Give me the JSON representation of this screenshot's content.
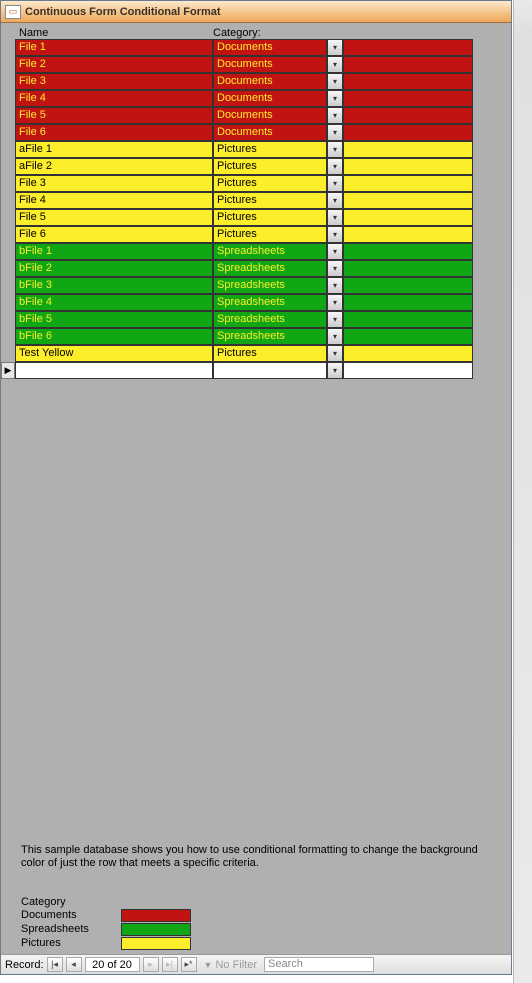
{
  "window": {
    "title": "Continuous Form Conditional Format"
  },
  "headers": {
    "name": "Name",
    "category": "Category:"
  },
  "rows": [
    {
      "name": "File 1",
      "category": "Documents",
      "class": "bg-red"
    },
    {
      "name": "File 2",
      "category": "Documents",
      "class": "bg-red"
    },
    {
      "name": "File 3",
      "category": "Documents",
      "class": "bg-red"
    },
    {
      "name": "File 4",
      "category": "Documents",
      "class": "bg-red"
    },
    {
      "name": "File 5",
      "category": "Documents",
      "class": "bg-red"
    },
    {
      "name": "File 6",
      "category": "Documents",
      "class": "bg-red"
    },
    {
      "name": "aFile 1",
      "category": "Pictures",
      "class": "bg-yellow"
    },
    {
      "name": "aFile 2",
      "category": "Pictures",
      "class": "bg-yellow"
    },
    {
      "name": "File 3",
      "category": "Pictures",
      "class": "bg-yellow"
    },
    {
      "name": "File 4",
      "category": "Pictures",
      "class": "bg-yellow"
    },
    {
      "name": "File 5",
      "category": "Pictures",
      "class": "bg-yellow"
    },
    {
      "name": "File 6",
      "category": "Pictures",
      "class": "bg-yellow"
    },
    {
      "name": "bFile 1",
      "category": "Spreadsheets",
      "class": "bg-green"
    },
    {
      "name": "bFile 2",
      "category": "Spreadsheets",
      "class": "bg-green"
    },
    {
      "name": "bFile 3",
      "category": "Spreadsheets",
      "class": "bg-green"
    },
    {
      "name": "bFile 4",
      "category": "Spreadsheets",
      "class": "bg-green"
    },
    {
      "name": "bFile 5",
      "category": "Spreadsheets",
      "class": "bg-green"
    },
    {
      "name": "bFile 6",
      "category": "Spreadsheets",
      "class": "bg-green"
    },
    {
      "name": "Test Yellow",
      "category": "Pictures",
      "class": "bg-yellow"
    }
  ],
  "new_row": {
    "name": "",
    "category": "",
    "class": "bg-white",
    "current": true
  },
  "footer": {
    "text": "This sample database shows you how to use conditional formatting to change the background color of just the row that meets a specific criteria."
  },
  "legend": {
    "title": "Category",
    "items": [
      {
        "label": "Documents",
        "color": "#c21313"
      },
      {
        "label": "Spreadsheets",
        "color": "#11a614"
      },
      {
        "label": "Pictures",
        "color": "#fcee2a"
      }
    ]
  },
  "nav": {
    "label": "Record:",
    "counter": "20 of 20",
    "no_filter": "No Filter",
    "search": "Search"
  }
}
